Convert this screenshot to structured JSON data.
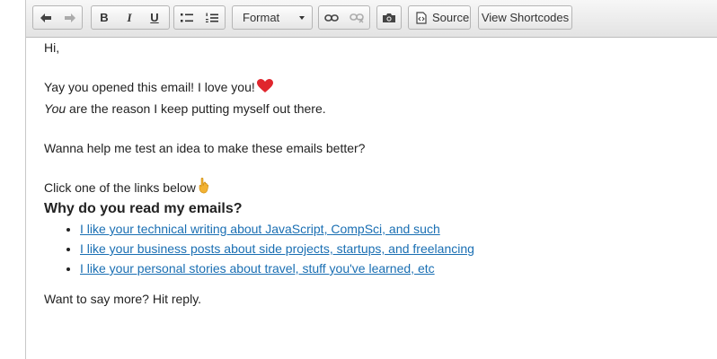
{
  "toolbar": {
    "format_label": "Format",
    "source_label": "Source",
    "view_shortcodes_label": "View Shortcodes",
    "bold_label": "B",
    "italic_label": "I",
    "underline_label": "U"
  },
  "content": {
    "greeting": "Hi,",
    "line1": "Yay you opened this email! I love you!",
    "line2_em": "You",
    "line2_rest": " are the reason I keep putting myself out there.",
    "line3": "Wanna help me test an idea to make these emails better?",
    "line4": "Click one of the links below",
    "heading": "Why do you read my emails?",
    "links": [
      "I like your technical writing about JavaScript, CompSci, and such",
      "I like your business posts about side projects, startups, and freelancing",
      "I like your personal stories about travel, stuff you've learned, etc"
    ],
    "closing": "Want to say more? Hit reply."
  },
  "colors": {
    "link": "#1a6fb3",
    "heart": "#e0262d",
    "hand": "#f2b233"
  }
}
